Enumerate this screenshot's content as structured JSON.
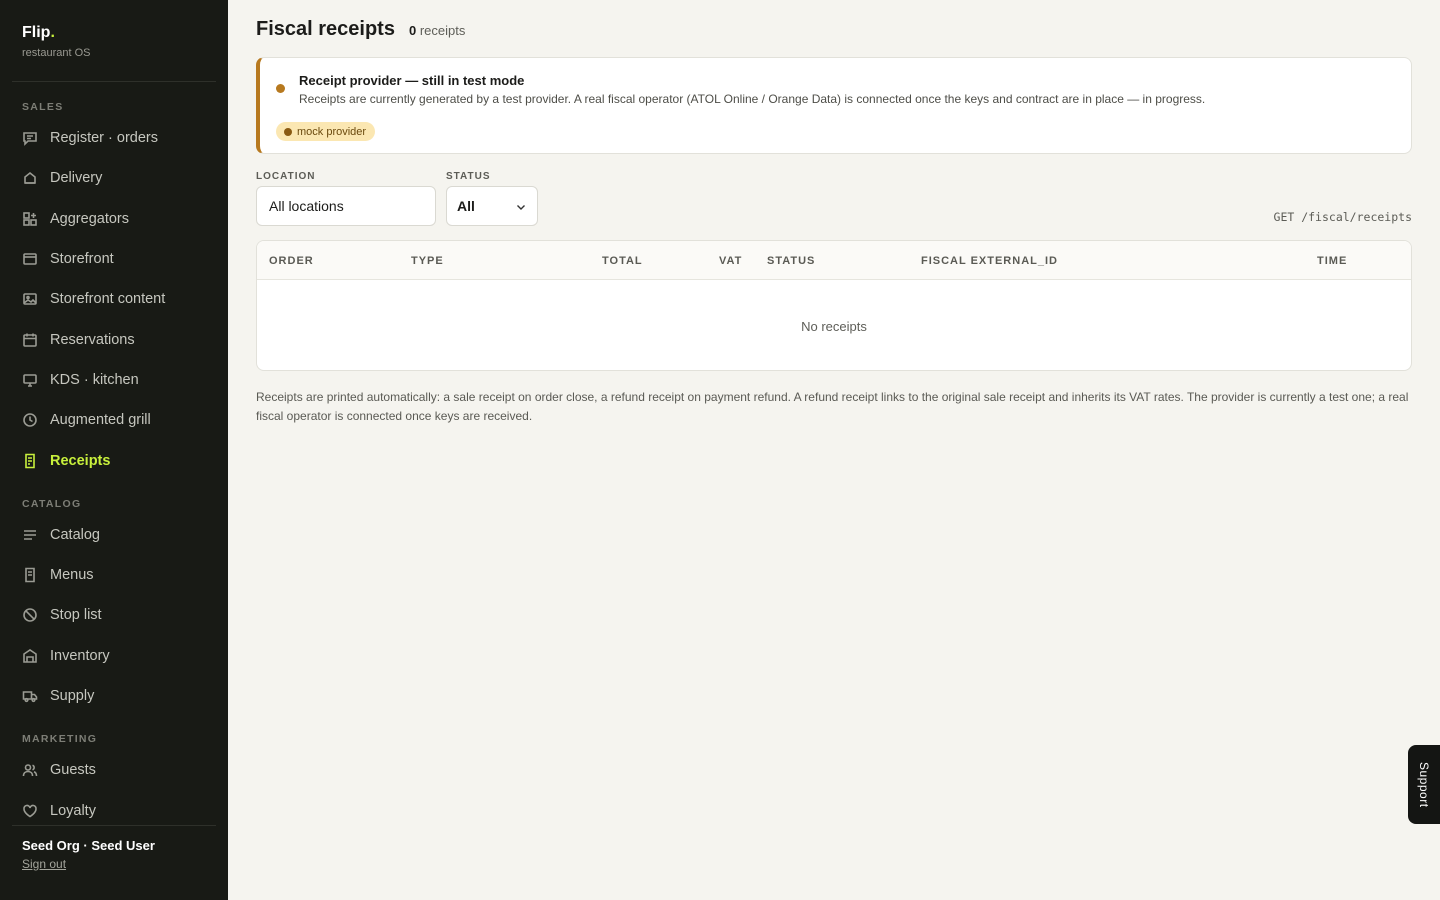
{
  "brand": {
    "name": "Flip",
    "dot": ".",
    "subtitle": "restaurant OS"
  },
  "sidebar": {
    "sections": [
      {
        "label": "SALES",
        "items": [
          {
            "label": "Register · orders",
            "icon": "message-square-icon"
          },
          {
            "label": "Delivery",
            "icon": "bag-icon"
          },
          {
            "label": "Aggregators",
            "icon": "grid-plus-icon"
          },
          {
            "label": "Storefront",
            "icon": "browser-window-icon"
          },
          {
            "label": "Storefront content",
            "icon": "image-icon"
          },
          {
            "label": "Reservations",
            "icon": "calendar-icon"
          },
          {
            "label": "KDS · kitchen",
            "icon": "monitor-icon"
          },
          {
            "label": "Augmented grill",
            "icon": "clock-icon"
          },
          {
            "label": "Receipts",
            "icon": "receipt-icon",
            "active": true
          }
        ]
      },
      {
        "label": "CATALOG",
        "items": [
          {
            "label": "Catalog",
            "icon": "list-icon"
          },
          {
            "label": "Menus",
            "icon": "menu-book-icon"
          },
          {
            "label": "Stop list",
            "icon": "ban-icon"
          },
          {
            "label": "Inventory",
            "icon": "warehouse-icon"
          },
          {
            "label": "Supply",
            "icon": "truck-icon"
          }
        ]
      },
      {
        "label": "MARKETING",
        "items": [
          {
            "label": "Guests",
            "icon": "users-icon"
          },
          {
            "label": "Loyalty",
            "icon": "heart-icon"
          }
        ]
      }
    ],
    "user": "Seed Org · Seed User",
    "signout": "Sign out"
  },
  "header": {
    "title": "Fiscal receipts",
    "count": "0",
    "count_label": "receipts"
  },
  "banner": {
    "title": "Receipt provider — still in test mode",
    "text": "Receipts are currently generated by a test provider. A real fiscal operator (ATOL Online / Orange Data) is connected once the keys and contract are in place — in progress.",
    "pill": "mock provider",
    "accent": "#b7791f"
  },
  "filters": {
    "location_label": "LOCATION",
    "location_value": "All locations",
    "status_label": "STATUS",
    "status_value": "All"
  },
  "endpoint": "GET /fiscal/receipts",
  "table": {
    "columns": [
      "ORDER",
      "TYPE",
      "TOTAL",
      "VAT",
      "STATUS",
      "FISCAL EXTERNAL_ID",
      "TIME"
    ],
    "rows": [],
    "empty": "No receipts"
  },
  "note": "Receipts are printed automatically: a sale receipt on order close, a refund receipt on payment refund. A refund receipt links to the original sale receipt and inherits its VAT rates. The provider is currently a test one; a real fiscal operator is connected once keys are received.",
  "support": "Support",
  "colors": {
    "sidebar_bg": "#181a15",
    "accent": "#c8f03c",
    "background": "#f5f4ef"
  }
}
